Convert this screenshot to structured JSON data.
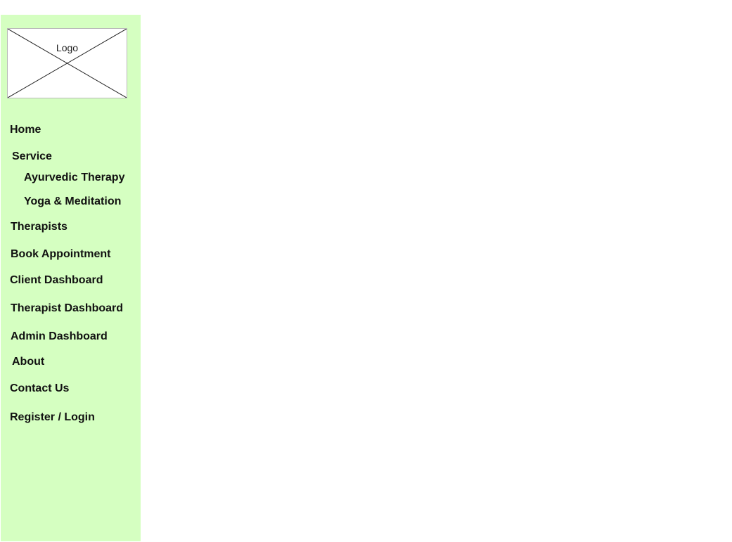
{
  "colors": {
    "sidebar_background": "#d5ffc1",
    "page_background": "#ffffff",
    "text": "#111111"
  },
  "logo": {
    "label": "Logo"
  },
  "nav": {
    "home": "Home",
    "service": "Service",
    "service_items": [
      "Ayurvedic Therapy",
      "Yoga & Meditation"
    ],
    "therapists": "Therapists",
    "book_appointment": "Book Appointment",
    "client_dashboard": "Client Dashboard",
    "therapist_dashboard": "Therapist Dashboard",
    "admin_dashboard": "Admin Dashboard",
    "about": "About",
    "contact_us": "Contact Us",
    "register_login": "Register / Login"
  }
}
